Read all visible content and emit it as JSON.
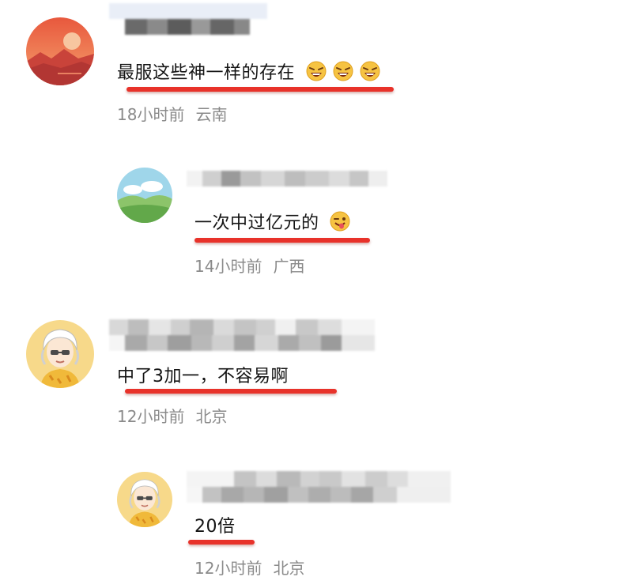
{
  "comments": [
    {
      "text": "最服这些神一样的存在",
      "emoji_count": 3,
      "time": "18小时前",
      "location": "云南"
    },
    {
      "text": "一次中过亿元的",
      "emoji_count": 1,
      "time": "14小时前",
      "location": "广西"
    },
    {
      "text": "中了3加一，不容易啊",
      "emoji_count": 0,
      "time": "12小时前",
      "location": "北京"
    },
    {
      "text": "20倍",
      "emoji_count": 0,
      "time": "12小时前",
      "location": "北京"
    }
  ],
  "colors": {
    "underline": "#e8322a",
    "meta_text": "#8a8a8a",
    "body_text": "#141414"
  },
  "icons": [
    "sunset-avatar-icon",
    "landscape-avatar-icon",
    "cartoon-person-avatar-icon",
    "laughing-emoji-icon",
    "tongue-wink-emoji-icon"
  ]
}
